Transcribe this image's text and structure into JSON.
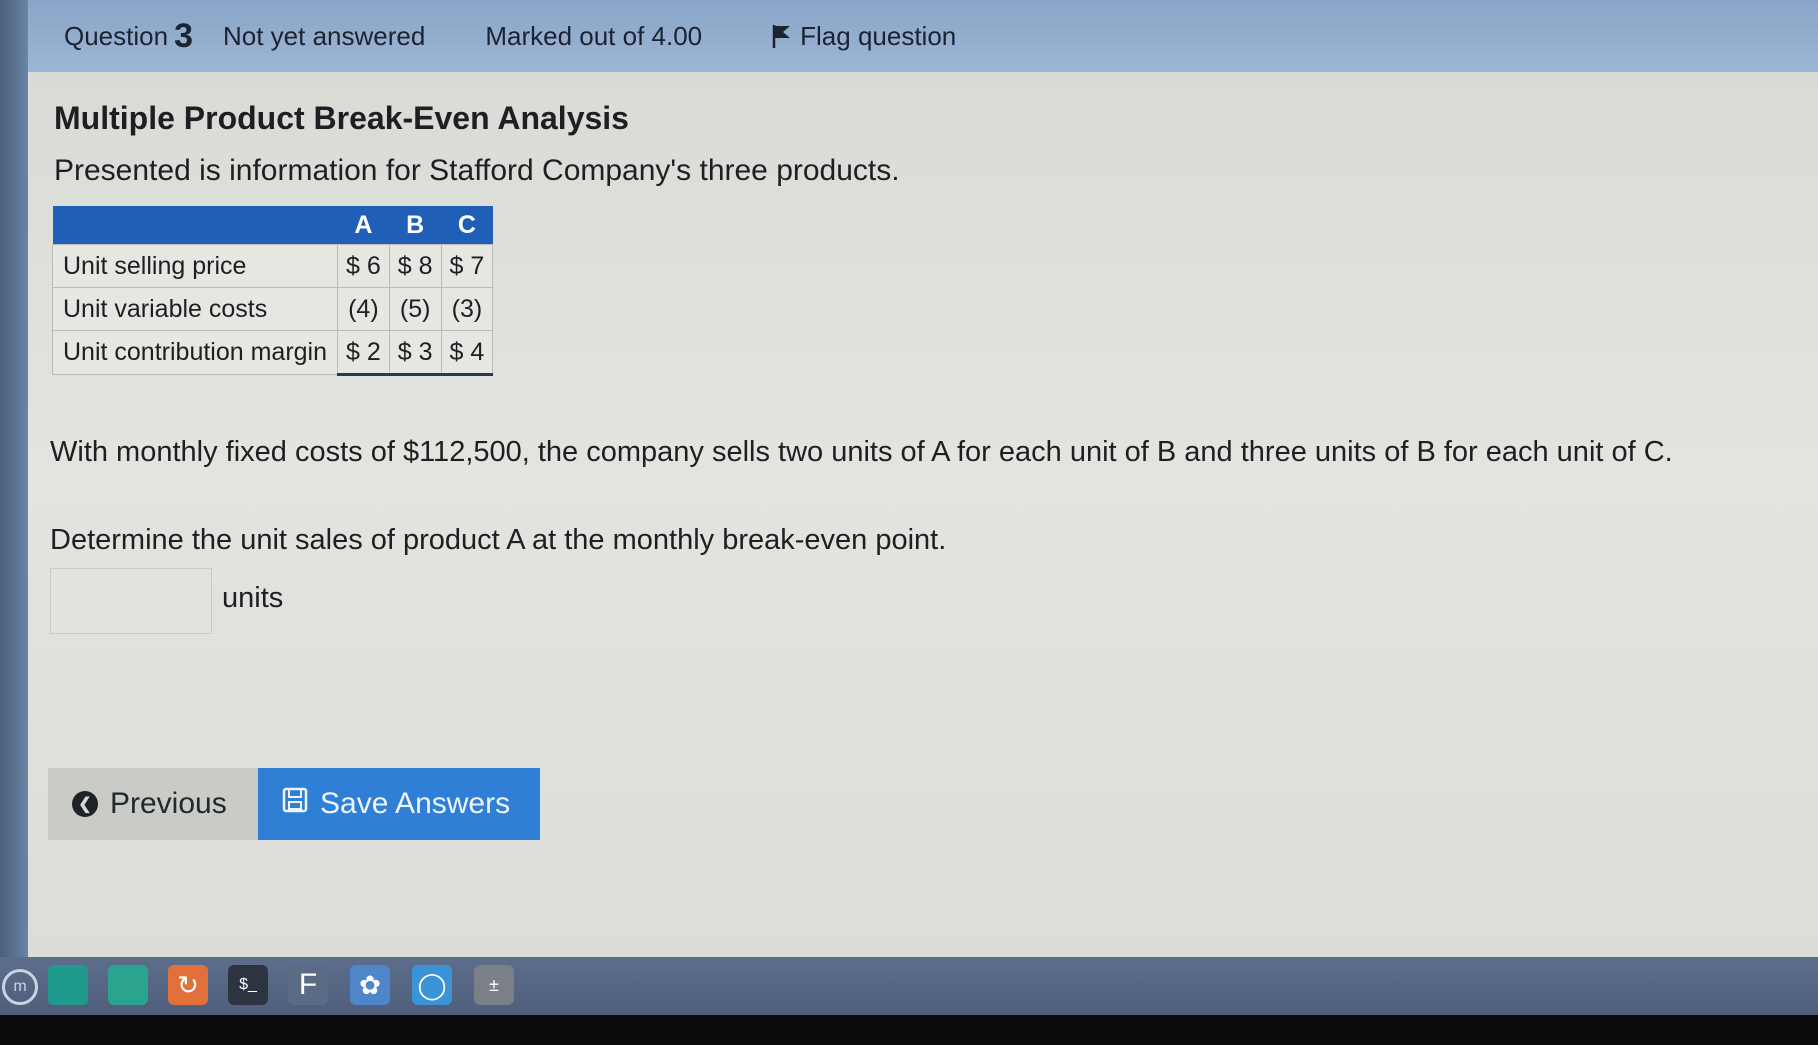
{
  "info_bar": {
    "question_label": "Question",
    "question_number": "3",
    "state": "Not yet answered",
    "marks": "Marked out of 4.00",
    "flag_label": "Flag question"
  },
  "question": {
    "title": "Multiple Product Break-Even Analysis",
    "intro": "Presented is information for Stafford Company's three products.",
    "table": {
      "columns": [
        "A",
        "B",
        "C"
      ],
      "rows": [
        {
          "label": "Unit selling price",
          "values": [
            "$ 6",
            "$ 8",
            "$ 7"
          ]
        },
        {
          "label": "Unit variable costs",
          "values": [
            "(4)",
            "(5)",
            "(3)"
          ]
        },
        {
          "label": "Unit contribution margin",
          "values": [
            "$ 2",
            "$ 3",
            "$ 4"
          ]
        }
      ]
    },
    "paragraph": "With monthly fixed costs of $112,500, the company sells two units of A for each unit of B and three units of B for each unit of C.",
    "prompt": "Determine the unit sales of product A at the monthly break-even point.",
    "answer_value": "",
    "answer_unit": "units"
  },
  "buttons": {
    "previous": "Previous",
    "save": "Save Answers"
  },
  "taskbar": {
    "icons": [
      "launcher-icon",
      "screen-icon",
      "files-icon",
      "app-icon",
      "terminal-icon",
      "text-editor-icon",
      "settings-icon",
      "camera-icon",
      "calculator-icon"
    ],
    "terminal_text": "$_",
    "editor_text": "F"
  }
}
